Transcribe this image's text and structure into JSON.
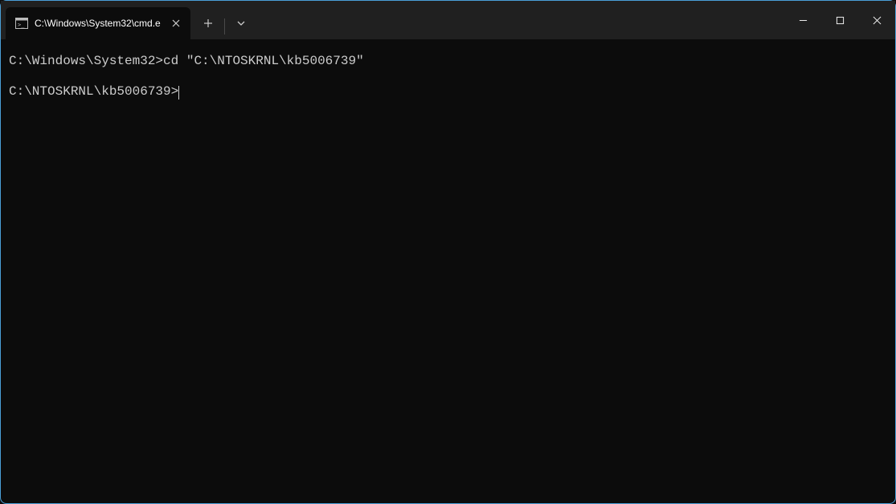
{
  "tab": {
    "title": "C:\\Windows\\System32\\cmd.e"
  },
  "terminal": {
    "lines": [
      {
        "prompt": "C:\\Windows\\System32>",
        "command": "cd \"C:\\NTOSKRNL\\kb5006739\""
      },
      {
        "blank": true
      },
      {
        "prompt": "C:\\NTOSKRNL\\kb5006739>",
        "command": "",
        "cursor": true
      }
    ]
  }
}
